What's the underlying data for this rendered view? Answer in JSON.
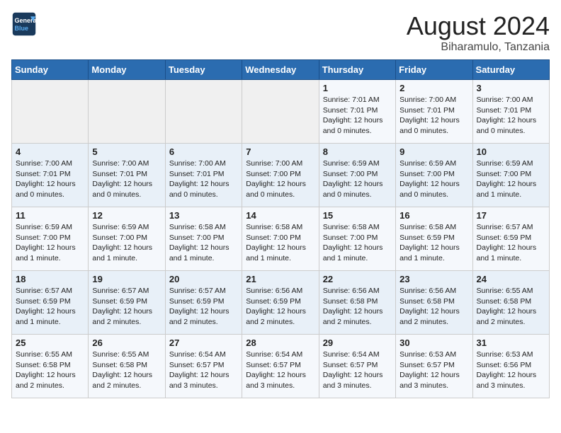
{
  "header": {
    "logo_line1": "General",
    "logo_line2": "Blue",
    "month_title": "August 2024",
    "location": "Biharamulo, Tanzania"
  },
  "weekdays": [
    "Sunday",
    "Monday",
    "Tuesday",
    "Wednesday",
    "Thursday",
    "Friday",
    "Saturday"
  ],
  "weeks": [
    [
      {
        "day": "",
        "info": ""
      },
      {
        "day": "",
        "info": ""
      },
      {
        "day": "",
        "info": ""
      },
      {
        "day": "",
        "info": ""
      },
      {
        "day": "1",
        "info": "Sunrise: 7:01 AM\nSunset: 7:01 PM\nDaylight: 12 hours\nand 0 minutes."
      },
      {
        "day": "2",
        "info": "Sunrise: 7:00 AM\nSunset: 7:01 PM\nDaylight: 12 hours\nand 0 minutes."
      },
      {
        "day": "3",
        "info": "Sunrise: 7:00 AM\nSunset: 7:01 PM\nDaylight: 12 hours\nand 0 minutes."
      }
    ],
    [
      {
        "day": "4",
        "info": "Sunrise: 7:00 AM\nSunset: 7:01 PM\nDaylight: 12 hours\nand 0 minutes."
      },
      {
        "day": "5",
        "info": "Sunrise: 7:00 AM\nSunset: 7:01 PM\nDaylight: 12 hours\nand 0 minutes."
      },
      {
        "day": "6",
        "info": "Sunrise: 7:00 AM\nSunset: 7:01 PM\nDaylight: 12 hours\nand 0 minutes."
      },
      {
        "day": "7",
        "info": "Sunrise: 7:00 AM\nSunset: 7:00 PM\nDaylight: 12 hours\nand 0 minutes."
      },
      {
        "day": "8",
        "info": "Sunrise: 6:59 AM\nSunset: 7:00 PM\nDaylight: 12 hours\nand 0 minutes."
      },
      {
        "day": "9",
        "info": "Sunrise: 6:59 AM\nSunset: 7:00 PM\nDaylight: 12 hours\nand 0 minutes."
      },
      {
        "day": "10",
        "info": "Sunrise: 6:59 AM\nSunset: 7:00 PM\nDaylight: 12 hours\nand 1 minute."
      }
    ],
    [
      {
        "day": "11",
        "info": "Sunrise: 6:59 AM\nSunset: 7:00 PM\nDaylight: 12 hours\nand 1 minute."
      },
      {
        "day": "12",
        "info": "Sunrise: 6:59 AM\nSunset: 7:00 PM\nDaylight: 12 hours\nand 1 minute."
      },
      {
        "day": "13",
        "info": "Sunrise: 6:58 AM\nSunset: 7:00 PM\nDaylight: 12 hours\nand 1 minute."
      },
      {
        "day": "14",
        "info": "Sunrise: 6:58 AM\nSunset: 7:00 PM\nDaylight: 12 hours\nand 1 minute."
      },
      {
        "day": "15",
        "info": "Sunrise: 6:58 AM\nSunset: 7:00 PM\nDaylight: 12 hours\nand 1 minute."
      },
      {
        "day": "16",
        "info": "Sunrise: 6:58 AM\nSunset: 6:59 PM\nDaylight: 12 hours\nand 1 minute."
      },
      {
        "day": "17",
        "info": "Sunrise: 6:57 AM\nSunset: 6:59 PM\nDaylight: 12 hours\nand 1 minute."
      }
    ],
    [
      {
        "day": "18",
        "info": "Sunrise: 6:57 AM\nSunset: 6:59 PM\nDaylight: 12 hours\nand 1 minute."
      },
      {
        "day": "19",
        "info": "Sunrise: 6:57 AM\nSunset: 6:59 PM\nDaylight: 12 hours\nand 2 minutes."
      },
      {
        "day": "20",
        "info": "Sunrise: 6:57 AM\nSunset: 6:59 PM\nDaylight: 12 hours\nand 2 minutes."
      },
      {
        "day": "21",
        "info": "Sunrise: 6:56 AM\nSunset: 6:59 PM\nDaylight: 12 hours\nand 2 minutes."
      },
      {
        "day": "22",
        "info": "Sunrise: 6:56 AM\nSunset: 6:58 PM\nDaylight: 12 hours\nand 2 minutes."
      },
      {
        "day": "23",
        "info": "Sunrise: 6:56 AM\nSunset: 6:58 PM\nDaylight: 12 hours\nand 2 minutes."
      },
      {
        "day": "24",
        "info": "Sunrise: 6:55 AM\nSunset: 6:58 PM\nDaylight: 12 hours\nand 2 minutes."
      }
    ],
    [
      {
        "day": "25",
        "info": "Sunrise: 6:55 AM\nSunset: 6:58 PM\nDaylight: 12 hours\nand 2 minutes."
      },
      {
        "day": "26",
        "info": "Sunrise: 6:55 AM\nSunset: 6:58 PM\nDaylight: 12 hours\nand 2 minutes."
      },
      {
        "day": "27",
        "info": "Sunrise: 6:54 AM\nSunset: 6:57 PM\nDaylight: 12 hours\nand 3 minutes."
      },
      {
        "day": "28",
        "info": "Sunrise: 6:54 AM\nSunset: 6:57 PM\nDaylight: 12 hours\nand 3 minutes."
      },
      {
        "day": "29",
        "info": "Sunrise: 6:54 AM\nSunset: 6:57 PM\nDaylight: 12 hours\nand 3 minutes."
      },
      {
        "day": "30",
        "info": "Sunrise: 6:53 AM\nSunset: 6:57 PM\nDaylight: 12 hours\nand 3 minutes."
      },
      {
        "day": "31",
        "info": "Sunrise: 6:53 AM\nSunset: 6:56 PM\nDaylight: 12 hours\nand 3 minutes."
      }
    ]
  ]
}
